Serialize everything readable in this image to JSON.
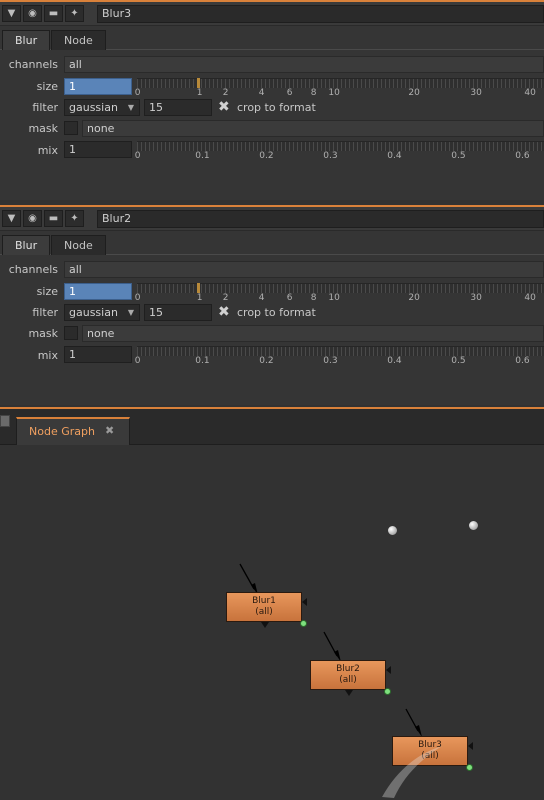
{
  "panels": [
    {
      "name": "Blur3",
      "tabs": [
        "Blur",
        "Node"
      ],
      "channels": "all",
      "size": "1",
      "filter": "gaussian",
      "filter_quality": "15",
      "crop_label": "crop to format",
      "mask": "none",
      "mix": "1",
      "labels": {
        "channels": "channels",
        "size": "size",
        "filter": "filter",
        "mask": "mask",
        "mix": "mix"
      },
      "size_ticks": [
        "0",
        "1",
        "2",
        "4",
        "6",
        "8",
        "10",
        "20",
        "30",
        "40"
      ],
      "mix_ticks": [
        "0",
        "0.1",
        "0.2",
        "0.3",
        "0.4",
        "0.5",
        "0.6"
      ]
    },
    {
      "name": "Blur2",
      "tabs": [
        "Blur",
        "Node"
      ],
      "channels": "all",
      "size": "1",
      "filter": "gaussian",
      "filter_quality": "15",
      "crop_label": "crop to format",
      "mask": "none",
      "mix": "1",
      "labels": {
        "channels": "channels",
        "size": "size",
        "filter": "filter",
        "mask": "mask",
        "mix": "mix"
      },
      "size_ticks": [
        "0",
        "1",
        "2",
        "4",
        "6",
        "8",
        "10",
        "20",
        "30",
        "40"
      ],
      "mix_ticks": [
        "0",
        "0.1",
        "0.2",
        "0.3",
        "0.4",
        "0.5",
        "0.6"
      ]
    }
  ],
  "header_icons": [
    "collapse-triangle-icon",
    "viewer-icon",
    "camera-icon",
    "wrench-icon"
  ],
  "node_graph": {
    "tab_label": "Node Graph",
    "close_glyph": "✖",
    "nodes": [
      {
        "name": "Blur1",
        "sub": "(all)"
      },
      {
        "name": "Blur2",
        "sub": "(all)"
      },
      {
        "name": "Blur3",
        "sub": "(all)"
      }
    ]
  },
  "colors": {
    "accent": "#d9813a",
    "node": "#d9844b",
    "size_field": "#5a84b8"
  }
}
